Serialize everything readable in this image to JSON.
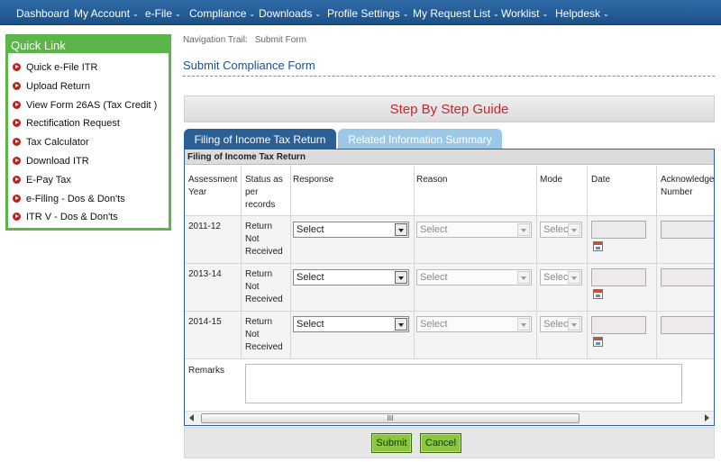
{
  "topnav": [
    {
      "label": "Dashboard",
      "has_menu": false
    },
    {
      "label": "My Account",
      "has_menu": true
    },
    {
      "label": "e-File",
      "has_menu": true
    },
    {
      "label": "Compliance",
      "has_menu": true
    },
    {
      "label": "Downloads",
      "has_menu": true
    },
    {
      "label": "Profile Settings",
      "has_menu": true
    },
    {
      "label": "My Request List",
      "has_menu": true
    },
    {
      "label": "Worklist",
      "has_menu": true
    },
    {
      "label": "Helpdesk",
      "has_menu": true
    }
  ],
  "quick_link": {
    "title": "Quick Link",
    "items": [
      "Quick e-File ITR",
      "Upload Return",
      "View Form 26AS (Tax Credit )",
      "Rectification Request",
      "Tax Calculator",
      "Download ITR",
      "E-Pay Tax",
      "e-Filing - Dos & Don'ts",
      "ITR V - Dos & Don'ts"
    ]
  },
  "breadcrumb": {
    "label": "Navigation Trail:",
    "value": "Submit Form"
  },
  "page_title": "Submit Compliance Form",
  "guide_title": "Step By Step Guide",
  "tabs": [
    {
      "label": "Filing of Income Tax Return",
      "active": true
    },
    {
      "label": "Related Information Summary",
      "active": false
    }
  ],
  "table": {
    "caption": "Filing of Income Tax Return",
    "headers": {
      "year": [
        "Assessment",
        "Year"
      ],
      "status": [
        "Status as",
        "per",
        "records"
      ],
      "response": "Response",
      "reason": "Reason",
      "mode": "Mode",
      "date": "Date",
      "ack": [
        "Acknowledge",
        "Number"
      ]
    },
    "rows": [
      {
        "year": "2011-12",
        "status": [
          "Return",
          "Not",
          "Received"
        ],
        "response": "Select",
        "reason": "Select",
        "mode": "Selec"
      },
      {
        "year": "2013-14",
        "status": [
          "Return",
          "Not",
          "Received"
        ],
        "response": "Select",
        "reason": "Select",
        "mode": "Selec"
      },
      {
        "year": "2014-15",
        "status": [
          "Return",
          "Not",
          "Received"
        ],
        "response": "Select",
        "reason": "Select",
        "mode": "Selec"
      }
    ],
    "remarks_label": "Remarks",
    "remarks_value": ""
  },
  "scrollbar_grip": "III",
  "buttons": {
    "submit": "Submit",
    "cancel": "Cancel"
  },
  "colors": {
    "nav": "#1c5188",
    "quick_link": "#5cb549",
    "guide_text": "#c3282e",
    "button": "#8cc63f"
  }
}
